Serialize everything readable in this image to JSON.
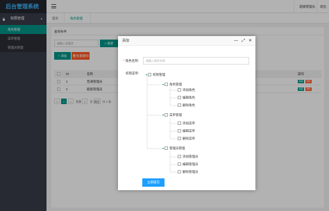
{
  "app": {
    "title": "后台管理系统"
  },
  "sidebar": {
    "group_label": "权限管理",
    "items": [
      {
        "label": "角色管理",
        "active": true
      },
      {
        "label": "菜单管理",
        "active": false
      },
      {
        "label": "管理员管理",
        "active": false
      }
    ]
  },
  "header": {
    "user_menu": "超级管理员",
    "logout": "退出"
  },
  "tabs": [
    {
      "label": "首页"
    },
    {
      "label": "角色管理",
      "close": "×"
    }
  ],
  "search": {
    "title": "查询条件",
    "placeholder": "请输入关键字",
    "button_label": "搜索"
  },
  "toolbar": {
    "add_label": "添加",
    "batch_delete_label": "批量删除"
  },
  "table": {
    "headers": {
      "id": "ID",
      "name": "名称",
      "op": "操作"
    },
    "rows": [
      {
        "id": "1",
        "name": "普通管理员"
      },
      {
        "id": "2",
        "name": "超级管理员"
      }
    ],
    "edit_label": "编辑",
    "delete_label": "删除"
  },
  "pager": {
    "prev": "<",
    "current": "1",
    "next": ">",
    "goto_prefix": "到第",
    "goto_value": "1",
    "goto_suffix": "页",
    "confirm": "确定",
    "total": "共 2 条"
  },
  "dialog": {
    "title": "添加",
    "min": "—",
    "max": "⤢",
    "close": "✕",
    "required_mark": "*",
    "role_label": "角色名称:",
    "role_placeholder": "请输入角色名称",
    "perm_label": "权限菜单:",
    "tree": {
      "root": "权限管理",
      "groups": [
        {
          "label": "角色管理",
          "children": [
            "添加角色",
            "编辑角色",
            "删除角色"
          ]
        },
        {
          "label": "菜单管理",
          "children": [
            "添加菜单",
            "编辑菜单",
            "删除菜单"
          ]
        },
        {
          "label": "管理员管理",
          "children": [
            "添加管理员",
            "编辑管理员",
            "删除管理员"
          ]
        }
      ]
    },
    "submit_label": "立即提交"
  },
  "colors": {
    "accent": "#009688",
    "danger": "#ff5722",
    "primary": "#1e9fff",
    "sidebar": "#393d49",
    "logo": "#3fb6ff"
  }
}
